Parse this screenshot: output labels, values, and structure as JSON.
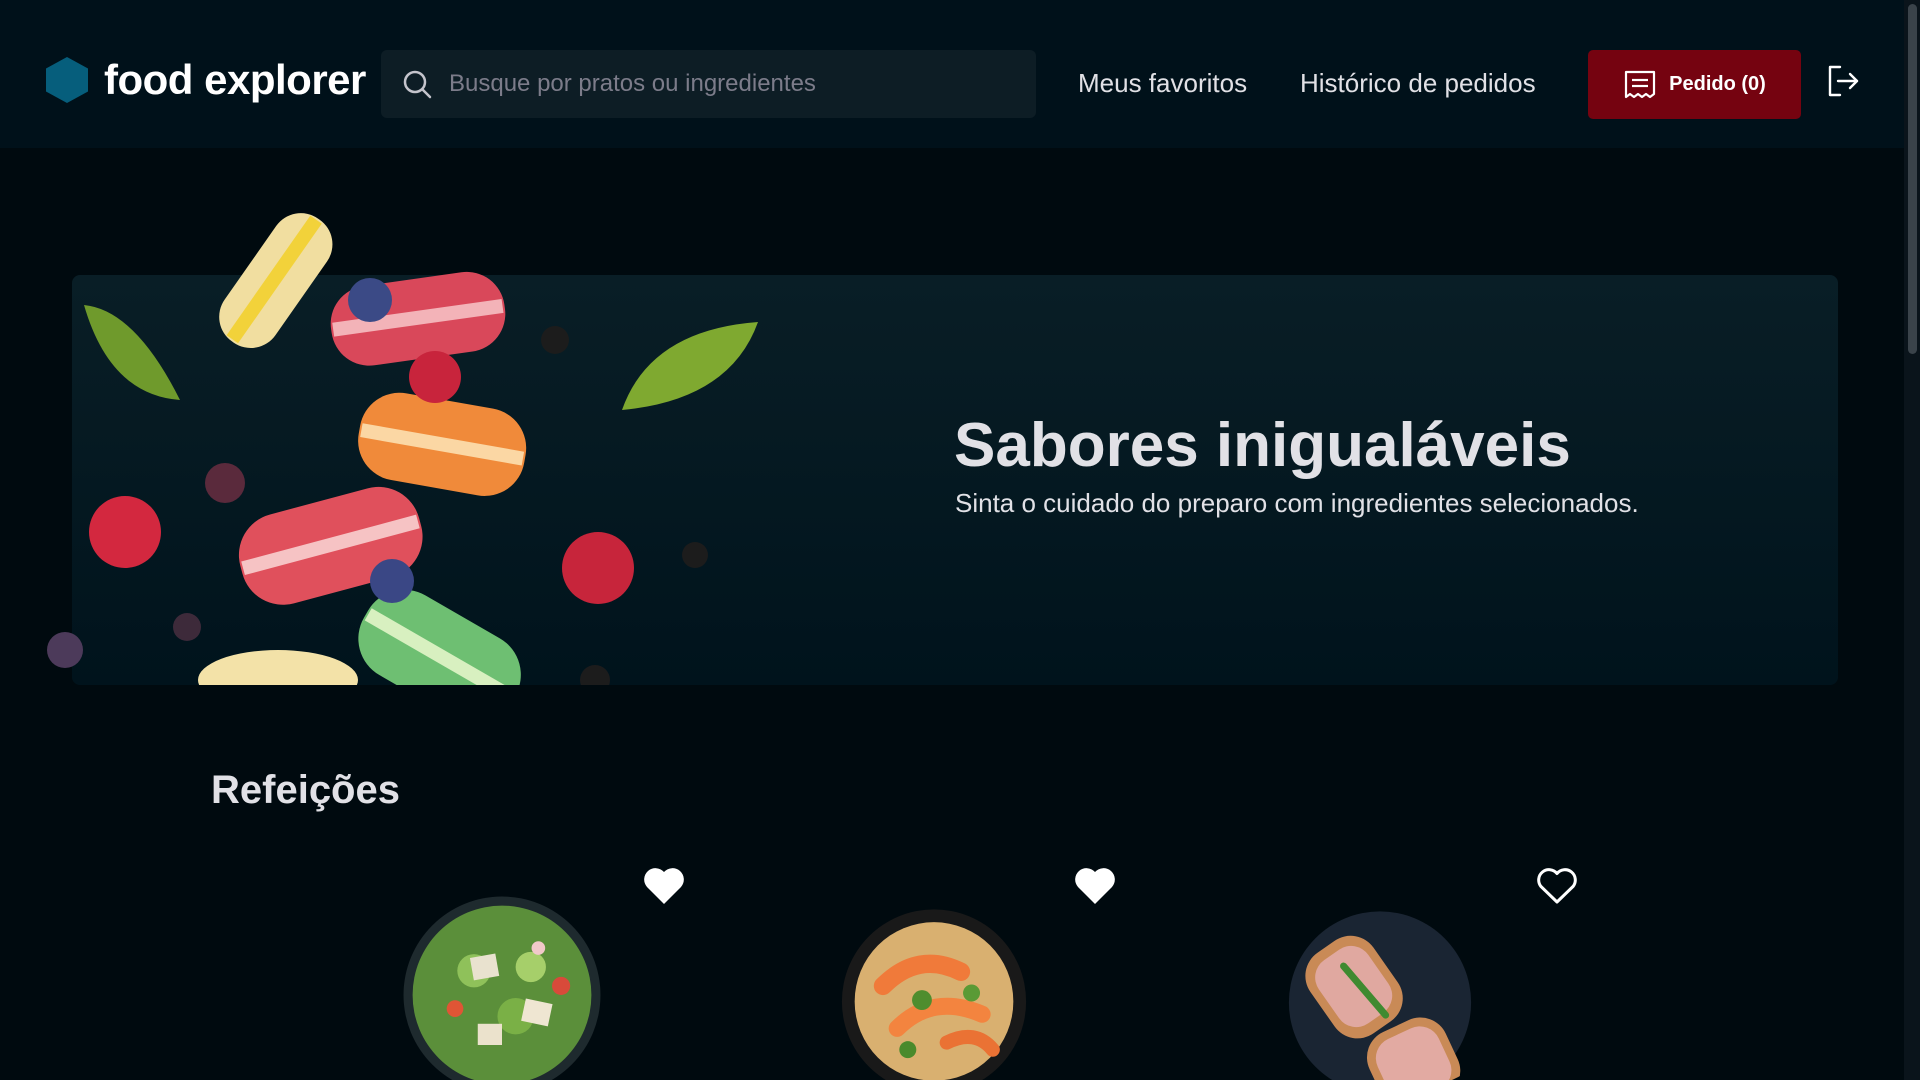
{
  "brand": {
    "name": "food explorer",
    "logo_icon": "hexagon-logo-icon",
    "accent": "#065e7c"
  },
  "search": {
    "placeholder": "Busque por pratos ou ingredientes",
    "value": "",
    "icon": "search-icon"
  },
  "nav": {
    "favorites": "Meus favoritos",
    "history": "Histórico de pedidos"
  },
  "order_button": {
    "label": "Pedido (0)",
    "icon": "receipt-icon",
    "color": "#750310"
  },
  "logout": {
    "icon": "sign-out-icon"
  },
  "banner": {
    "title": "Sabores inigualáveis",
    "subtitle": "Sinta o cuidado do preparo com ingredientes selecionados."
  },
  "section": {
    "title": "Refeições",
    "dishes": [
      {
        "image": "salad-dish-image",
        "favorited": true
      },
      {
        "image": "shrimp-pasta-dish-image",
        "favorited": true
      },
      {
        "image": "bruschetta-dish-image",
        "favorited": false
      }
    ]
  },
  "colors": {
    "background": "#000a0f",
    "header": "#00111a",
    "text": "#e1e1e6",
    "placeholder": "#7c7c8a"
  }
}
